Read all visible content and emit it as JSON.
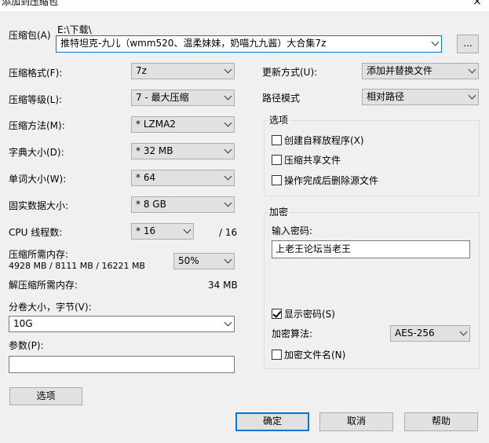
{
  "window": {
    "title": "添加到压缩包",
    "close_glyph": "×"
  },
  "archive": {
    "label": "压缩包(A)",
    "path": "E:\\下载\\",
    "name": "推特坦克-九儿（wmm520、温柔妹妹，奶喵九九酱）大合集7z",
    "browse_label": "..."
  },
  "left": {
    "format_label": "压缩格式(F):",
    "format_value": "7z",
    "level_label": "压缩等级(L):",
    "level_value": "7 - 最大压缩",
    "method_label": "压缩方法(M):",
    "method_value": "* LZMA2",
    "dict_label": "字典大小(D):",
    "dict_value": "* 32 MB",
    "word_label": "单词大小(W):",
    "word_value": "* 64",
    "solid_label": "固实数据大小:",
    "solid_value": "* 8 GB",
    "cpu_label": "CPU 线程数:",
    "cpu_value": "* 16",
    "cpu_total": "/ 16",
    "mem_label": "压缩所需内存:",
    "mem_detail": "4928 MB / 8111 MB / 16221 MB",
    "mem_percent": "50%",
    "decomp_label": "解压缩所需内存:",
    "decomp_value": "34 MB",
    "volume_label": "分卷大小，字节(V):",
    "volume_value": "10G",
    "params_label": "参数(P):",
    "params_value": "",
    "options_button": "选项"
  },
  "right": {
    "update_label": "更新方式(U):",
    "update_value": "添加并替换文件",
    "pathmode_label": "路径模式",
    "pathmode_value": "相对路径",
    "options_group": "选项",
    "opt_sfx": "创建自释放程序(X)",
    "opt_shared": "压缩共享文件",
    "opt_delete": "操作完成后删除源文件",
    "encrypt_group": "加密",
    "password_label": "输入密码:",
    "password_value": "上老王论坛当老王",
    "show_password": "显示密码(S)",
    "enc_method_label": "加密算法:",
    "enc_method_value": "AES-256",
    "encrypt_names": "加密文件名(N)"
  },
  "buttons": {
    "ok": "确定",
    "cancel": "取消",
    "help": "帮助"
  }
}
